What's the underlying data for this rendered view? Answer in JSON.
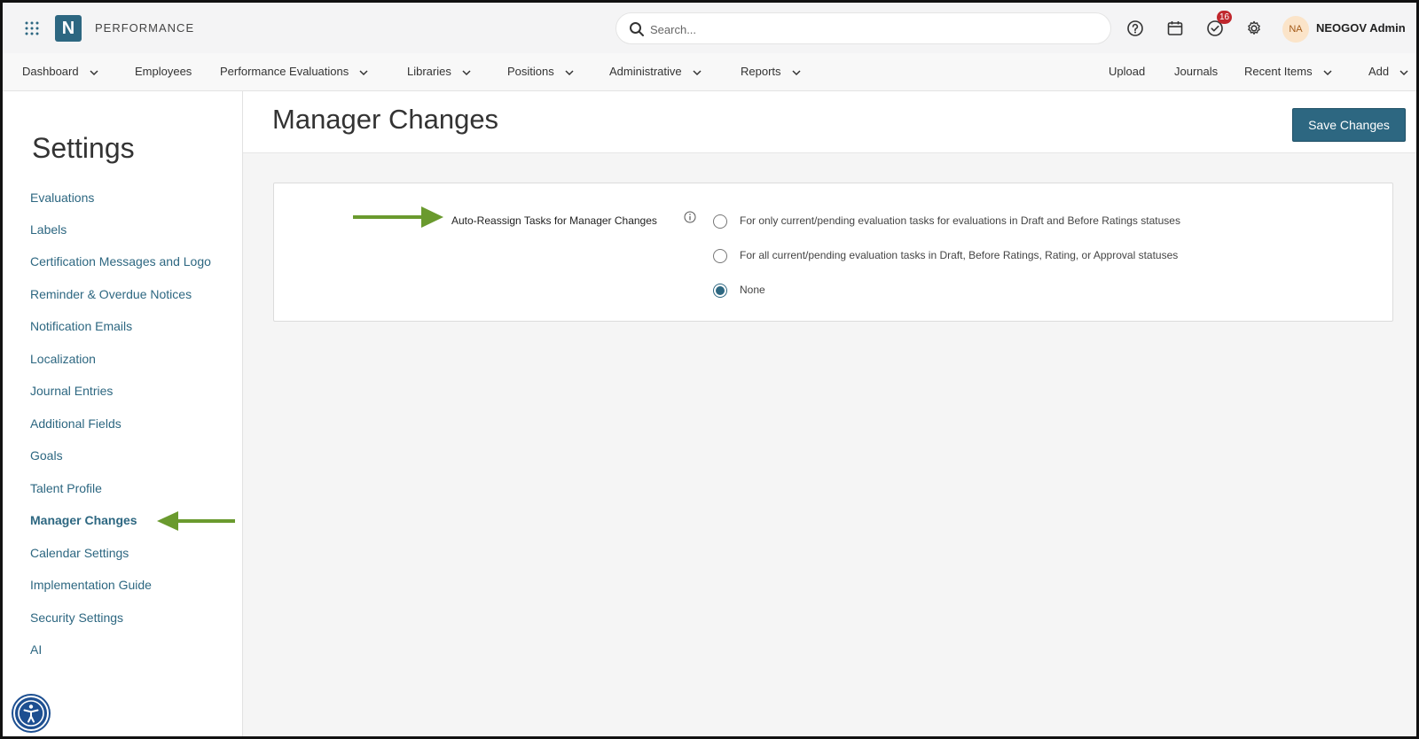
{
  "app": {
    "name": "PERFORMANCE",
    "logo_letter": "N"
  },
  "search": {
    "placeholder": "Search..."
  },
  "topbar": {
    "icons": [
      "help-icon",
      "calendar-icon",
      "tasks-icon",
      "gear-icon"
    ],
    "tasks_badge": "16",
    "user_initials": "NA",
    "user_name": "NEOGOV Admin"
  },
  "nav": {
    "left": [
      {
        "label": "Dashboard",
        "dropdown": true
      },
      {
        "label": "Employees",
        "dropdown": false
      },
      {
        "label": "Performance Evaluations",
        "dropdown": true
      },
      {
        "label": "Libraries",
        "dropdown": true
      },
      {
        "label": "Positions",
        "dropdown": true
      },
      {
        "label": "Administrative",
        "dropdown": true
      },
      {
        "label": "Reports",
        "dropdown": true
      }
    ],
    "right": [
      {
        "label": "Upload",
        "dropdown": false
      },
      {
        "label": "Journals",
        "dropdown": false
      },
      {
        "label": "Recent Items",
        "dropdown": true
      },
      {
        "label": "Add",
        "dropdown": true
      }
    ]
  },
  "sidebar": {
    "title": "Settings",
    "items": [
      "Evaluations",
      "Labels",
      "Certification Messages and Logo",
      "Reminder & Overdue Notices",
      "Notification Emails",
      "Localization",
      "Journal Entries",
      "Additional Fields",
      "Goals",
      "Talent Profile",
      "Manager Changes",
      "Calendar Settings",
      "Implementation Guide",
      "Security Settings",
      "AI"
    ],
    "active_item": "Manager Changes"
  },
  "main": {
    "title": "Manager Changes",
    "save_label": "Save Changes",
    "field_label": "Auto-Reassign Tasks for Manager Changes",
    "options": [
      "For only current/pending evaluation tasks for evaluations in Draft and Before Ratings statuses",
      "For all current/pending evaluation tasks in Draft, Before Ratings, Rating, or Approval statuses",
      "None"
    ],
    "selected_option": "None"
  },
  "colors": {
    "brand": "#2d6781",
    "annotation_arrow": "#6a9a2e",
    "badge": "#c0272d",
    "accessibility": "#1d4f91"
  }
}
